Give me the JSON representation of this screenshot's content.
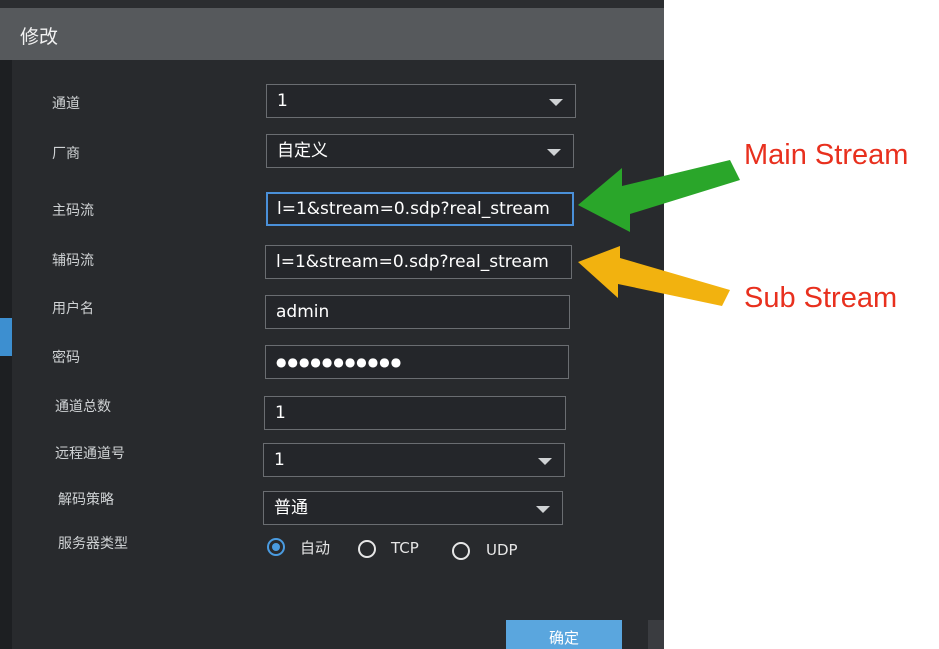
{
  "dialog": {
    "title": "修改",
    "ok_label": "确定"
  },
  "fields": {
    "channel": {
      "label": "通道",
      "value": "1"
    },
    "vendor": {
      "label": "厂商",
      "value": "自定义"
    },
    "main_stream": {
      "label": "主码流",
      "value": "l=1&stream=0.sdp?real_stream"
    },
    "sub_stream": {
      "label": "辅码流",
      "value": "l=1&stream=0.sdp?real_stream"
    },
    "username": {
      "label": "用户名",
      "value": "admin"
    },
    "password": {
      "label": "密码",
      "value": "●●●●●●●●●●●"
    },
    "channel_total": {
      "label": "通道总数",
      "value": "1"
    },
    "remote_channel": {
      "label": "远程通道号",
      "value": "1"
    },
    "decode_policy": {
      "label": "解码策略",
      "value": "普通"
    },
    "server_type": {
      "label": "服务器类型",
      "options": [
        "自动",
        "TCP",
        "UDP"
      ],
      "selected": "自动"
    }
  },
  "annotations": {
    "main": {
      "text": "Main Stream",
      "color": "#2aa62a"
    },
    "sub": {
      "text": "Sub Stream",
      "color": "#f2b20f"
    },
    "text_color": "#e8301e"
  }
}
